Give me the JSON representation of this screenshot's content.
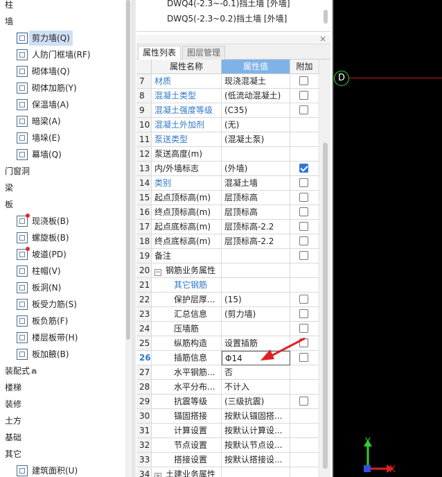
{
  "tree": {
    "categories": {
      "column": "柱",
      "wall": "墙",
      "door_window": "门窗洞",
      "beam": "梁",
      "slab": "板",
      "prefab": "装配式",
      "stair": "楼梯",
      "decoration": "装修",
      "earthwork": "土方",
      "foundation": "基础",
      "other": "其它"
    },
    "wall_items": [
      "剪力墙(Q)",
      "人防门框墙(RF)",
      "砌体墙(Q)",
      "砌体加筋(Y)",
      "保温墙(A)",
      "暗梁(A)",
      "墙垛(E)",
      "幕墙(Q)"
    ],
    "slab_items": [
      "现浇板(B)",
      "螺旋板(B)",
      "坡道(PD)",
      "柱帽(V)",
      "板洞(N)",
      "板受力筋(S)",
      "板负筋(F)",
      "楼层板带(H)",
      "板加腋(B)"
    ],
    "other_items": [
      "建筑面积(U)"
    ],
    "selected": "剪力墙(Q)"
  },
  "layer_list": {
    "items": [
      "DWQ4(-2.3~-0.1)挡土墙 [外墙]",
      "DWQ5(-2.3~0.2)挡土墙 [外墙]"
    ]
  },
  "tabs": {
    "properties": "属性列表",
    "layers": "图层管理"
  },
  "grid": {
    "headers": {
      "name": "属性名称",
      "value": "属性值",
      "add": "附加"
    },
    "rows": [
      {
        "num": "7",
        "name": "材质",
        "value": "现浇混凝土",
        "check": false
      },
      {
        "num": "8",
        "name": "混凝土类型",
        "value": "(低流动混凝土)",
        "check": false
      },
      {
        "num": "9",
        "name": "混凝土强度等级",
        "value": "(C35)",
        "check": false
      },
      {
        "num": "10",
        "name": "混凝土外加剂",
        "value": "(无)"
      },
      {
        "num": "11",
        "name": "泵送类型",
        "value": "(混凝土泵)"
      },
      {
        "num": "12",
        "name": "泵送高度(m)",
        "value": ""
      },
      {
        "num": "13",
        "name": "内/外墙标志",
        "value": "(外墙)",
        "check": true
      },
      {
        "num": "14",
        "name": "类别",
        "value": "混凝土墙",
        "check": false
      },
      {
        "num": "15",
        "name": "起点顶标高(m)",
        "value": "层顶标高",
        "check": false
      },
      {
        "num": "16",
        "name": "终点顶标高(m)",
        "value": "层顶标高",
        "check": false
      },
      {
        "num": "17",
        "name": "起点底标高(m)",
        "value": "层顶标高-2.2",
        "check": false
      },
      {
        "num": "18",
        "name": "终点底标高(m)",
        "value": "层顶标高-2.2",
        "check": false
      },
      {
        "num": "19",
        "name": "备注",
        "value": "",
        "check": false
      },
      {
        "num": "20",
        "name": "钢筋业务属性",
        "value": ""
      },
      {
        "num": "21",
        "name": "其它钢筋",
        "value": ""
      },
      {
        "num": "22",
        "name": "保护层厚...",
        "value": "(15)",
        "check": false
      },
      {
        "num": "23",
        "name": "汇总信息",
        "value": "(剪力墙)",
        "check": false
      },
      {
        "num": "24",
        "name": "压墙筋",
        "value": "",
        "check": false
      },
      {
        "num": "25",
        "name": "纵筋构造",
        "value": "设置插筋",
        "check": false
      },
      {
        "num": "26",
        "name": "插筋信息",
        "value": "Φ14",
        "check": false
      },
      {
        "num": "27",
        "name": "水平钢筋...",
        "value": "否"
      },
      {
        "num": "28",
        "name": "水平分布...",
        "value": "不计入"
      },
      {
        "num": "29",
        "name": "抗震等级",
        "value": "(三级抗震)",
        "check": false
      },
      {
        "num": "30",
        "name": "锚固搭接",
        "value": "按默认锚固搭..."
      },
      {
        "num": "31",
        "name": "计算设置",
        "value": "按默认计算设..."
      },
      {
        "num": "32",
        "name": "节点设置",
        "value": "按默认节点设..."
      },
      {
        "num": "33",
        "name": "搭接设置",
        "value": "按默认搭接设..."
      },
      {
        "num": "34",
        "name": "土建业务属性",
        "value": ""
      }
    ]
  },
  "canvas": {
    "point_label": "D",
    "axis_y": "Y",
    "axis_x": "X",
    "colors": {
      "background": "#000000",
      "line": "#c81e1e",
      "axis_x": "#e02020",
      "axis_y": "#30d030",
      "accent": "#7fb3e8"
    }
  },
  "icons": {
    "close": "close-icon",
    "expand": "expand-icon",
    "collapse": "collapse-icon",
    "prefab_suffix": "lock-icon"
  },
  "symbols": {
    "collapse": "−",
    "expand": "+",
    "close": "×",
    "prefab_mark": "⋒"
  }
}
